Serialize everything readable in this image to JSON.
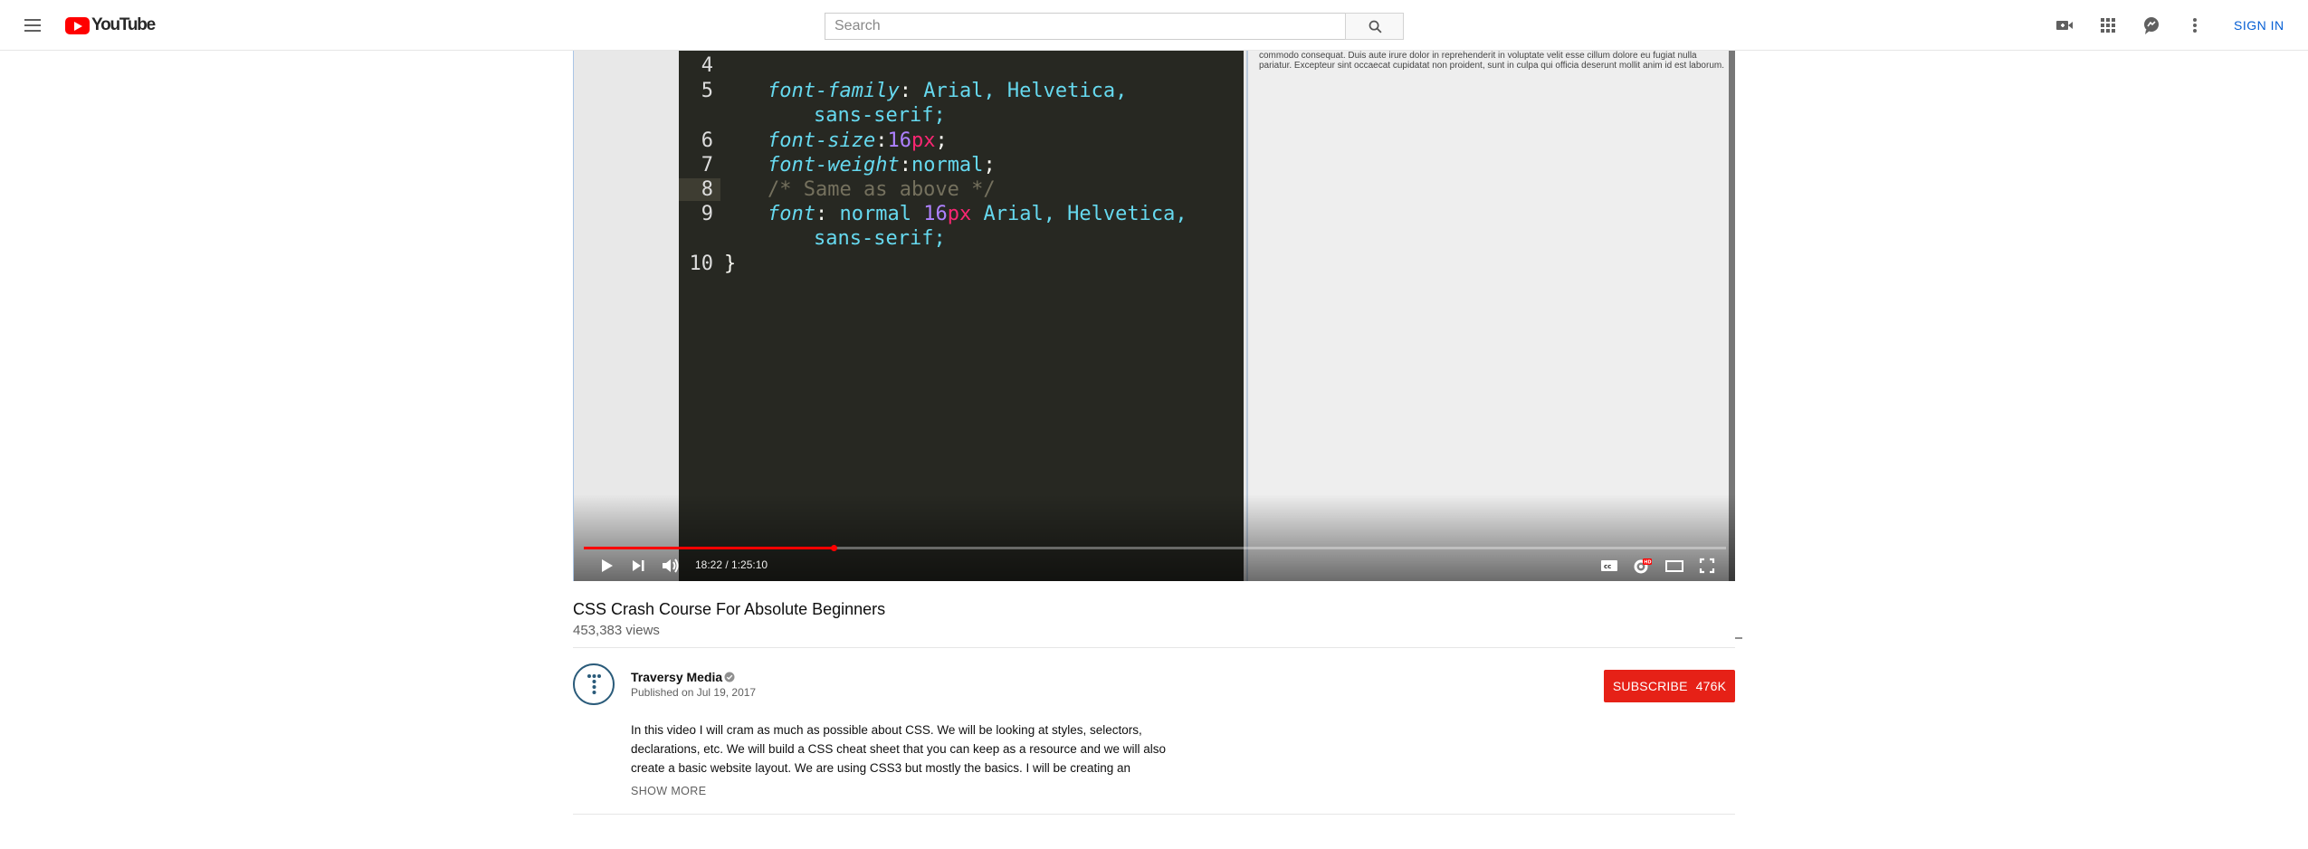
{
  "masthead": {
    "logo_text": "YouTube",
    "search_placeholder": "Search",
    "signin_label": "SIGN IN",
    "icons": [
      "menu-icon",
      "search-icon",
      "create-video-icon",
      "apps-grid-icon",
      "messages-icon",
      "more-vert-icon"
    ]
  },
  "player": {
    "code_lines": [
      {
        "num": "4",
        "text": ""
      },
      {
        "num": "5",
        "prop": "font-family",
        "rest": "Arial, Helvetica,",
        "cont": "sans-serif;"
      },
      {
        "num": "6",
        "prop": "font-size",
        "value": "16",
        "unit": "px"
      },
      {
        "num": "7",
        "prop": "font-weight",
        "rest": "normal"
      },
      {
        "num": "8",
        "comment": "/* Same as above */"
      },
      {
        "num": "9",
        "prop": "font",
        "rest": "normal",
        "value": "16",
        "unit": "px",
        "rest2": "Arial, Helvetica,",
        "cont": "sans-serif;"
      },
      {
        "num": "10",
        "brace": "}"
      }
    ],
    "preview_text": "commodo consequat. Duis aute irure dolor in reprehenderit in voluptate velit esse cillum dolore eu fugiat nulla pariatur. Excepteur sint occaecat cupidatat non proident, sunt in culpa qui officia deserunt mollit anim id est laborum.",
    "time_display": "18:22 / 1:25:10",
    "progress_fraction": 0.219,
    "controls": [
      "play-icon",
      "next-icon",
      "volume-icon",
      "captions-icon",
      "settings-icon",
      "theater-icon",
      "fullscreen-icon"
    ],
    "accent_color": "#ff0000"
  },
  "video": {
    "title": "CSS Crash Course For Absolute Beginners",
    "views": "453,383 views"
  },
  "channel": {
    "name": "Traversy Media",
    "published": "Published on Jul 19, 2017",
    "subscribe_label": "SUBSCRIBE",
    "subscriber_count": "476K",
    "subscribe_color": "#e62117"
  },
  "description": {
    "text": "In this video I will cram as much as possible about CSS. We will be looking at styles, selectors, declarations, etc. We will build a CSS cheat sheet that you can keep as a resource and we will also create a basic website layout. We are using CSS3 but mostly the basics. I will be creating an",
    "show_more_label": "SHOW MORE"
  }
}
